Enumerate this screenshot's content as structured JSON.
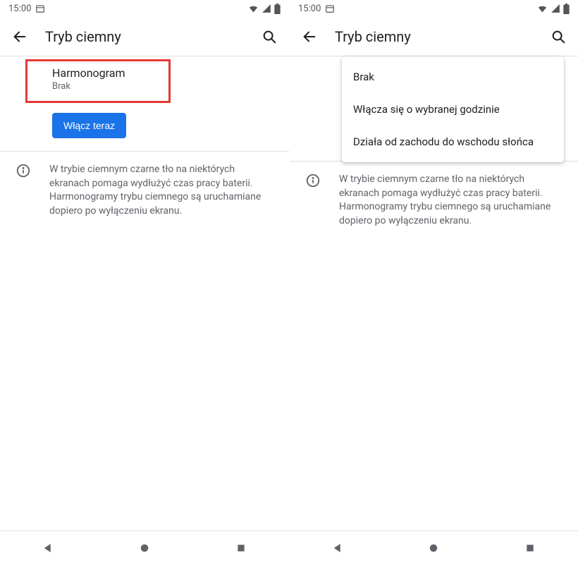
{
  "statusbar": {
    "time": "15:00"
  },
  "appbar": {
    "title": "Tryb ciemny"
  },
  "schedule": {
    "title": "Harmonogram",
    "value": "Brak"
  },
  "button": {
    "label": "Włącz teraz"
  },
  "info": {
    "text": "W trybie ciemnym czarne tło na niektórych ekranach pomaga wydłużyć czas pracy baterii. Harmonogramy trybu ciemnego są uruchamiane dopiero po wyłączeniu ekranu."
  },
  "dropdown": {
    "options": [
      "Brak",
      "Włącza się o wybranej godzinie",
      "Działa od zachodu do wschodu słońca"
    ]
  }
}
